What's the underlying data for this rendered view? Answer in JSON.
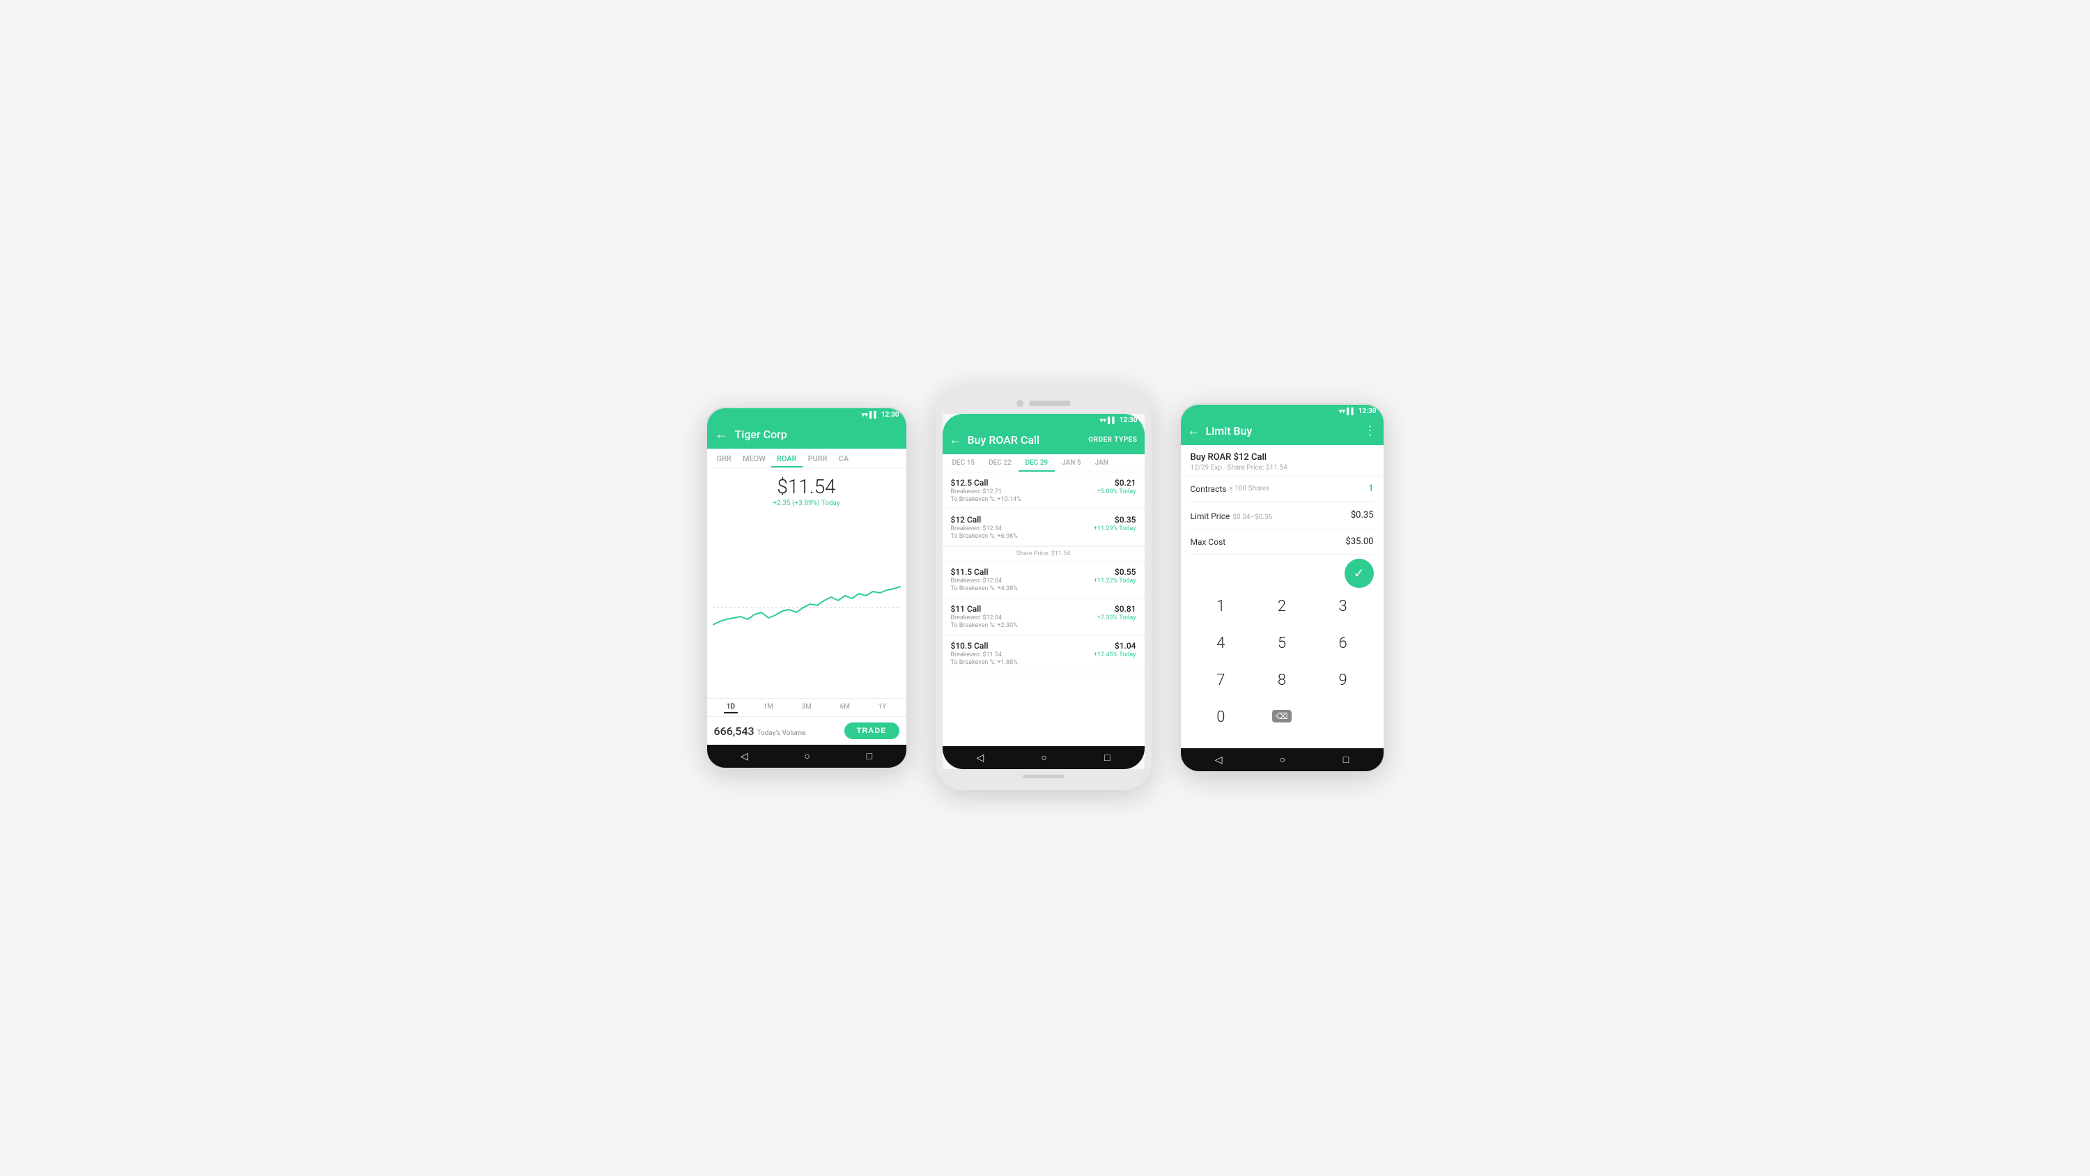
{
  "colors": {
    "green": "#2ecc8f",
    "dark": "#111111",
    "light_bg": "#f5f5f5",
    "text_primary": "#222222",
    "text_secondary": "#999999",
    "border": "#f0f0f0"
  },
  "phone_left": {
    "status_time": "12:30",
    "header_title": "Tiger Corp",
    "back_label": "←",
    "tabs": [
      "GRR",
      "MEOW",
      "ROAR",
      "PURR",
      "CA"
    ],
    "active_tab": "ROAR",
    "price": "$11.54",
    "price_change": "+2.35 (+3.89%) Today",
    "time_periods": [
      "1D",
      "1M",
      "3M",
      "6M",
      "1Y"
    ],
    "active_period": "1D",
    "volume": "666,543",
    "volume_label": "Today's Volume",
    "trade_button": "TRADE"
  },
  "phone_center": {
    "status_time": "12:30",
    "header_title": "Buy ROAR Call",
    "order_types_label": "ORDER TYPES",
    "back_label": "←",
    "dates": [
      "DEC 15",
      "DEC 22",
      "DEC 29",
      "JAN 5",
      "JAN"
    ],
    "active_date": "DEC 29",
    "options": [
      {
        "name": "$12.5 Call",
        "breakeven": "Breakeven: $12.71",
        "to_breakeven": "To Breakeven %: +10.14%",
        "price": "$0.21",
        "change": "+5.00% Today"
      },
      {
        "name": "$12 Call",
        "breakeven": "Breakeven: $12.34",
        "to_breakeven": "To Breakeven %: +6.98%",
        "price": "$0.35",
        "change": "+11.29% Today"
      },
      {
        "share_price_divider": "Share Price: $11.54"
      },
      {
        "name": "$11.5 Call",
        "breakeven": "Breakeven: $12.04",
        "to_breakeven": "To Breakeven %: +4.38%",
        "price": "$0.55",
        "change": "+11.22% Today"
      },
      {
        "name": "$11 Call",
        "breakeven": "Breakeven: $12.04",
        "to_breakeven": "To Breakeven %: +2.30%",
        "price": "$0.81",
        "change": "+7.33% Today"
      },
      {
        "name": "$10.5 Call",
        "breakeven": "Breakeven: $11.54",
        "to_breakeven": "To Breakeven %: +1.88%",
        "price": "$1.04",
        "change": "+12.45% Today"
      }
    ]
  },
  "phone_right": {
    "status_time": "12:30",
    "header_title": "Limit Buy",
    "back_label": "←",
    "order_title": "Buy ROAR $12 Call",
    "order_subtitle": "12/29 Exp · Share Price: $11.54",
    "contracts_label": "Contracts",
    "contracts_hint": "× 100 Shares",
    "contracts_value": "1",
    "limit_label": "Limit Price",
    "limit_hint": "$0.34–$0.36",
    "limit_value": "$0.35",
    "max_cost_label": "Max Cost",
    "max_cost_value": "$35.00",
    "numpad": [
      "1",
      "2",
      "3",
      "4",
      "5",
      "6",
      "7",
      "8",
      "9",
      "0",
      "⌫"
    ],
    "confirm_icon": "✓"
  }
}
